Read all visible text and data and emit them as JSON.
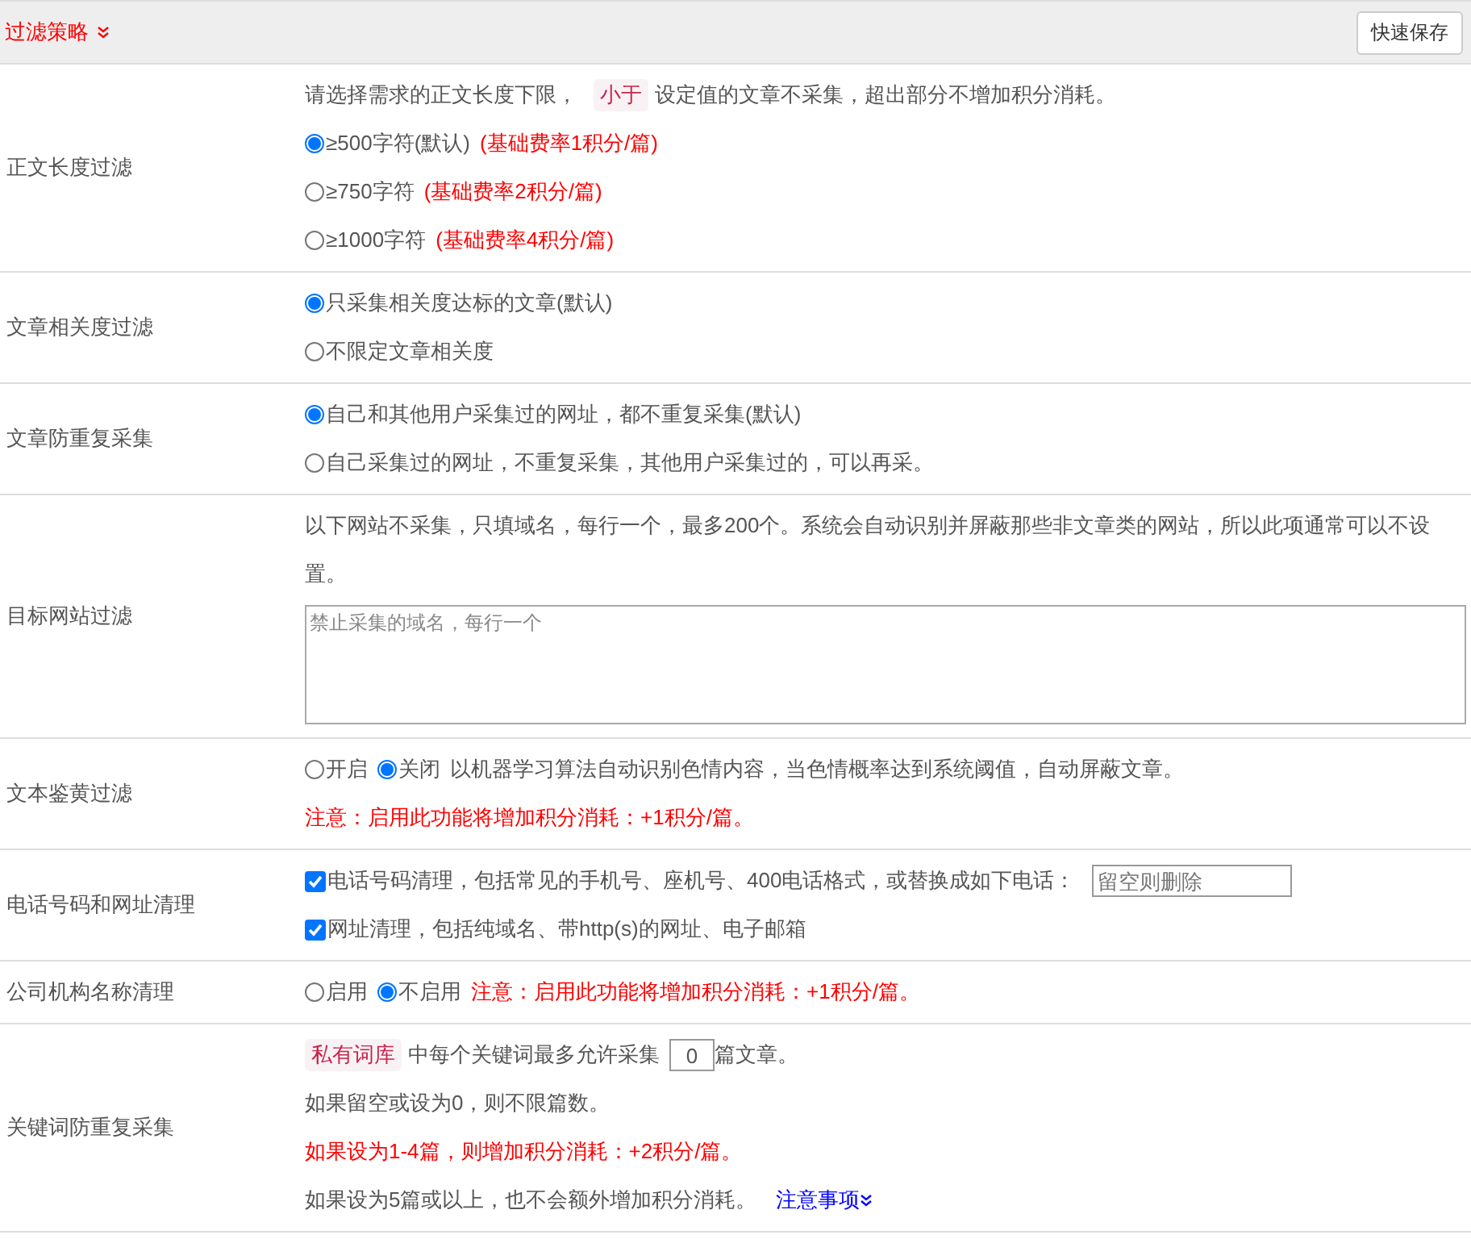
{
  "header": {
    "title": "过滤策略",
    "save_button": "快速保存"
  },
  "rows": [
    {
      "label": "正文长度过滤",
      "lines": [
        [
          {
            "kind": "text",
            "text": "请选择需求的正文长度下限，"
          },
          {
            "kind": "tag",
            "text": "小于"
          },
          {
            "kind": "text",
            "text": "设定值的文章不采集，超出部分不增加积分消耗。"
          }
        ],
        [
          {
            "kind": "radio",
            "text": "≥500字符(默认)",
            "selected": true
          },
          {
            "kind": "warn",
            "text": "(基础费率1积分/篇)"
          }
        ],
        [
          {
            "kind": "radio",
            "text": "≥750字符",
            "selected": false
          },
          {
            "kind": "warn",
            "text": "(基础费率2积分/篇)"
          }
        ],
        [
          {
            "kind": "radio",
            "text": "≥1000字符",
            "selected": false
          },
          {
            "kind": "warn",
            "text": "(基础费率4积分/篇)"
          }
        ]
      ]
    },
    {
      "label": "文章相关度过滤",
      "lines": [
        [
          {
            "kind": "radio",
            "text": "只采集相关度达标的文章(默认)",
            "selected": true
          }
        ],
        [
          {
            "kind": "radio",
            "text": "不限定文章相关度",
            "selected": false
          }
        ]
      ]
    },
    {
      "label": "文章防重复采集",
      "lines": [
        [
          {
            "kind": "radio",
            "text": "自己和其他用户采集过的网址，都不重复采集(默认)",
            "selected": true
          }
        ],
        [
          {
            "kind": "radio",
            "text": "自己采集过的网址，不重复采集，其他用户采集过的，可以再采。",
            "selected": false
          }
        ]
      ]
    },
    {
      "label": "目标网站过滤",
      "lines": [
        [
          {
            "kind": "text",
            "text": "以下网站不采集，只填域名，每行一个，最多200个。系统会自动识别并屏蔽那些非文章类的网站，所以此项通常可以不设置。"
          }
        ],
        [
          {
            "kind": "textarea",
            "placeholder": "禁止采集的域名，每行一个"
          }
        ]
      ]
    },
    {
      "label": "文本鉴黄过滤",
      "lines": [
        [
          {
            "kind": "radio",
            "text": "开启",
            "selected": false
          },
          {
            "kind": "radio",
            "text": "关闭",
            "selected": true
          },
          {
            "kind": "text",
            "text": "以机器学习算法自动识别色情内容，当色情概率达到系统阈值，自动屏蔽文章。"
          }
        ],
        [
          {
            "kind": "warn",
            "text": "注意：启用此功能将增加积分消耗：+1积分/篇。"
          }
        ]
      ]
    },
    {
      "label": "电话号码和网址清理",
      "lines": [
        [
          {
            "kind": "checkbox",
            "text": "电话号码清理，包括常见的手机号、座机号、400电话格式，或替换成如下电话：",
            "checked": true
          },
          {
            "kind": "input",
            "placeholder": "留空则删除"
          }
        ],
        [
          {
            "kind": "checkbox",
            "text": "网址清理，包括纯域名、带http(s)的网址、电子邮箱",
            "checked": true
          }
        ]
      ]
    },
    {
      "label": "公司机构名称清理",
      "lines": [
        [
          {
            "kind": "radio",
            "text": "启用",
            "selected": false
          },
          {
            "kind": "radio",
            "text": "不启用",
            "selected": true
          },
          {
            "kind": "warn",
            "text": "注意：启用此功能将增加积分消耗：+1积分/篇。"
          }
        ]
      ]
    },
    {
      "label": "关键词防重复采集",
      "lines": [
        [
          {
            "kind": "tag",
            "text": "私有词库"
          },
          {
            "kind": "text",
            "text": "中每个关键词最多允许采集"
          },
          {
            "kind": "number",
            "value": "0"
          },
          {
            "kind": "text",
            "text": "篇文章。"
          }
        ],
        [
          {
            "kind": "text",
            "text": "如果留空或设为0，则不限篇数。"
          }
        ],
        [
          {
            "kind": "warn",
            "text": "如果设为1-4篇，则增加积分消耗：+2积分/篇。"
          }
        ],
        [
          {
            "kind": "text",
            "text": "如果设为5篇或以上，也不会额外增加积分消耗。"
          },
          {
            "kind": "link",
            "text": "注意事项"
          }
        ]
      ]
    }
  ]
}
